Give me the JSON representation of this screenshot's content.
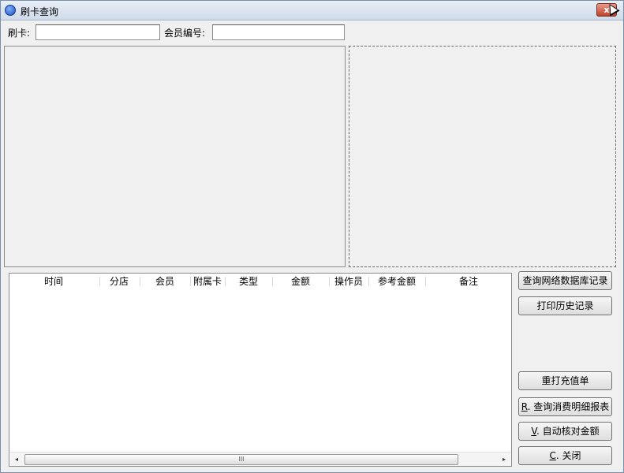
{
  "window": {
    "title": "刷卡查询",
    "close_label": "x"
  },
  "form": {
    "card_label": "刷卡:",
    "card_value": "",
    "member_no_label": "会员编号:",
    "member_no_value": ""
  },
  "table": {
    "columns": [
      "时间",
      "分店",
      "会员",
      "附属卡",
      "类型",
      "金额",
      "操作员",
      "参考金额",
      "备注"
    ],
    "rows": [],
    "scroll": {
      "left": "◂",
      "right": "▸",
      "grip": "III"
    }
  },
  "buttons": {
    "query_network": "查询网络数据库记录",
    "print_history": "打印历史记录",
    "reprint_recharge": "重打充值单",
    "query_consume": {
      "key": "R",
      "label": ". 查询消费明细报表"
    },
    "auto_check": {
      "key": "V",
      "label": ". 自动核对金额"
    },
    "close": {
      "key": "C",
      "label": ". 关闭"
    }
  }
}
